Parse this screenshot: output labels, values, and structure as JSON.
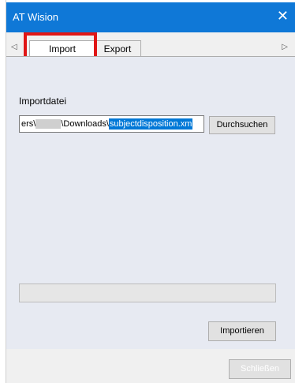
{
  "window": {
    "title": "AT Wision",
    "close_icon": "close-icon"
  },
  "tabs": {
    "left_arrow": "◁",
    "right_arrow": "▷",
    "import_label": "Import",
    "export_label": "Export"
  },
  "import_panel": {
    "field_label": "Importdatei",
    "path_prefix": "ers\\",
    "path_middle": "\\Downloads\\",
    "path_selected": "subjectdisposition.xm",
    "browse_label": "Durchsuchen",
    "progress": 0,
    "import_label": "Importieren"
  },
  "footer": {
    "close_label": "Schließen"
  },
  "colors": {
    "titlebar": "#0f78d7",
    "highlight": "#e01616",
    "selection": "#0078d7"
  }
}
